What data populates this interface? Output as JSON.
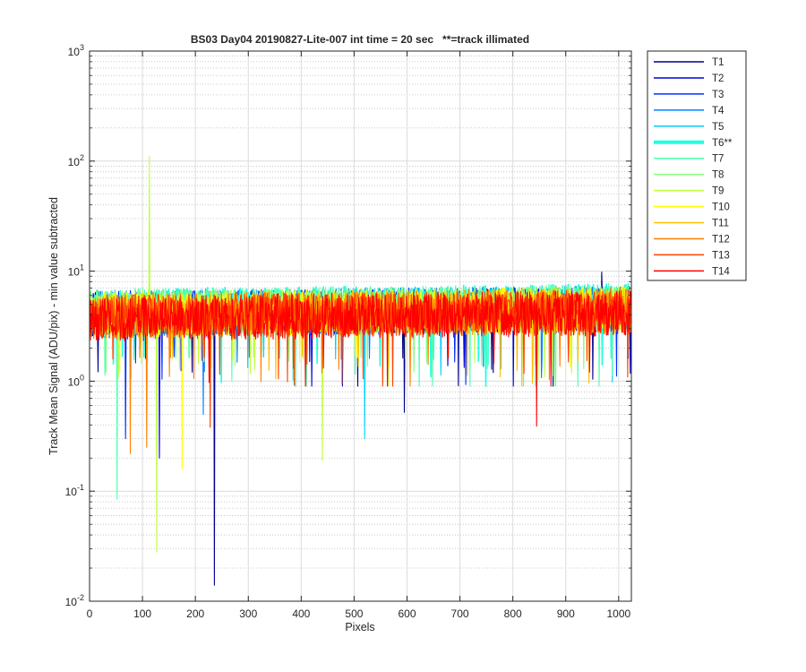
{
  "chart_data": {
    "type": "line",
    "title": "BS03 Day04 20190827-Lite-007 int time = 20 sec   **=track illimated",
    "xlabel": "Pixels",
    "ylabel": "Track Mean Signal (ADU/pix) - min value subtracted",
    "xlim": [
      0,
      1024
    ],
    "ylim": [
      0.01,
      1000
    ],
    "yscale": "log",
    "grid": true,
    "minor_grid": true,
    "legend_position": "outside-top-right",
    "x_ticks": [
      {
        "v": 0,
        "label": "0"
      },
      {
        "v": 100,
        "label": "100"
      },
      {
        "v": 200,
        "label": "200"
      },
      {
        "v": 300,
        "label": "300"
      },
      {
        "v": 400,
        "label": "400"
      },
      {
        "v": 500,
        "label": "500"
      },
      {
        "v": 600,
        "label": "600"
      },
      {
        "v": 700,
        "label": "700"
      },
      {
        "v": 800,
        "label": "800"
      },
      {
        "v": 900,
        "label": "900"
      },
      {
        "v": 1000,
        "label": "1000"
      }
    ],
    "y_ticks": [
      {
        "v": 0.01,
        "base": "10",
        "exp": "-2"
      },
      {
        "v": 0.1,
        "base": "10",
        "exp": "-1"
      },
      {
        "v": 1,
        "base": "10",
        "exp": "0"
      },
      {
        "v": 10,
        "base": "10",
        "exp": "1"
      },
      {
        "v": 100,
        "base": "10",
        "exp": "2"
      },
      {
        "v": 1000,
        "base": "10",
        "exp": "3"
      }
    ],
    "typical_range": [
      1.5,
      7.5
    ],
    "series": [
      {
        "name": "T1",
        "color": "#00008F",
        "width": 1.5,
        "level": 4.0,
        "spikes": [
          {
            "x": 236,
            "y": 0.014
          },
          {
            "x": 595,
            "y": 0.52
          },
          {
            "x": 968,
            "y": 9.8
          }
        ]
      },
      {
        "name": "T2",
        "color": "#0000DF",
        "width": 1.5,
        "level": 4.0,
        "spikes": [
          {
            "x": 132,
            "y": 0.2
          }
        ]
      },
      {
        "name": "T3",
        "color": "#0030FF",
        "width": 1.5,
        "level": 4.1,
        "spikes": [
          {
            "x": 68,
            "y": 0.3
          }
        ]
      },
      {
        "name": "T4",
        "color": "#0080FF",
        "width": 1.5,
        "level": 4.1,
        "spikes": [
          {
            "x": 215,
            "y": 0.5
          }
        ]
      },
      {
        "name": "T5",
        "color": "#00CFFF",
        "width": 1.5,
        "level": 4.2,
        "spikes": [
          {
            "x": 520,
            "y": 0.3
          }
        ]
      },
      {
        "name": "T6**",
        "color": "#20FFDF",
        "width": 4,
        "level": 4.3,
        "spikes": []
      },
      {
        "name": "T7",
        "color": "#50FFAF",
        "width": 1.5,
        "level": 4.3,
        "spikes": [
          {
            "x": 52,
            "y": 0.085
          }
        ]
      },
      {
        "name": "T8",
        "color": "#80FF80",
        "width": 1.5,
        "level": 4.2,
        "spikes": []
      },
      {
        "name": "T9",
        "color": "#BFFF40",
        "width": 1.5,
        "level": 4.1,
        "spikes": [
          {
            "x": 113,
            "y": 110
          },
          {
            "x": 127,
            "y": 0.028
          },
          {
            "x": 440,
            "y": 0.19
          }
        ]
      },
      {
        "name": "T10",
        "color": "#FFFF00",
        "width": 1.5,
        "level": 4.0,
        "spikes": [
          {
            "x": 175,
            "y": 0.16
          }
        ]
      },
      {
        "name": "T11",
        "color": "#FFBF00",
        "width": 1.5,
        "level": 3.9,
        "spikes": []
      },
      {
        "name": "T12",
        "color": "#FF8000",
        "width": 1.5,
        "level": 3.9,
        "spikes": [
          {
            "x": 77,
            "y": 0.22
          },
          {
            "x": 108,
            "y": 0.25
          }
        ]
      },
      {
        "name": "T13",
        "color": "#FF4000",
        "width": 1.5,
        "level": 3.8,
        "spikes": [
          {
            "x": 228,
            "y": 0.38
          }
        ]
      },
      {
        "name": "T14",
        "color": "#FF0000",
        "width": 1.5,
        "level": 3.7,
        "spikes": [
          {
            "x": 845,
            "y": 0.39
          }
        ]
      }
    ]
  }
}
